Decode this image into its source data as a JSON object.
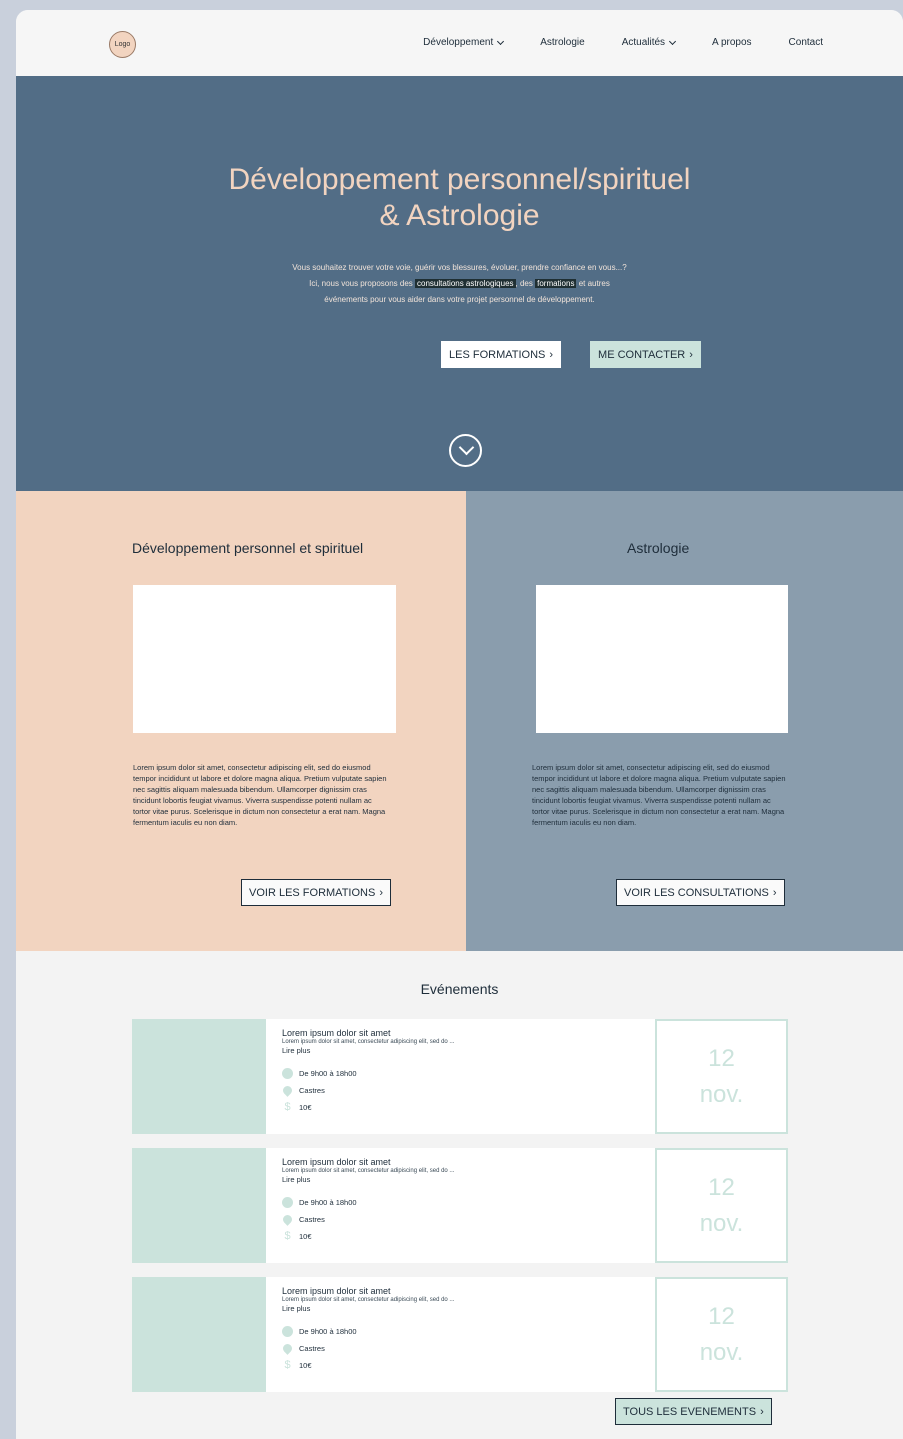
{
  "nav": {
    "logo": "Logo",
    "links": [
      {
        "label": "Développement",
        "dropdown": true
      },
      {
        "label": "Astrologie",
        "dropdown": false
      },
      {
        "label": "Actualités",
        "dropdown": true
      },
      {
        "label": "A propos",
        "dropdown": false
      },
      {
        "label": "Contact",
        "dropdown": false
      }
    ]
  },
  "hero": {
    "title_line1": "Développement personnel/spirituel",
    "title_line2": "& Astrologie",
    "text_line1": "Vous souhaitez trouver votre voie, guérir vos blessures, évoluer, prendre confiance en vous...?",
    "text_line2_a": "Ici, nous vous proposons des ",
    "text_line2_hl1": "consultations astrologiques",
    "text_line2_b": ", des ",
    "text_line2_hl2": "formations",
    "text_line2_c": " et autres",
    "text_line3": "événements pour vous aider dans votre projet personnel de développement.",
    "btn_formations": "LES FORMATIONS",
    "btn_contact": "ME CONTACTER",
    "arrow": "›"
  },
  "split": {
    "left": {
      "title": "Développement personnel et spirituel",
      "text": "Lorem ipsum dolor sit amet, consectetur adipiscing elit, sed do eiusmod tempor incididunt ut labore et dolore magna aliqua. Pretium vulputate sapien nec sagittis aliquam malesuada bibendum. Ullamcorper dignissim cras tincidunt lobortis feugiat vivamus. Viverra suspendisse potenti nullam ac tortor vitae purus. Scelerisque in dictum non consectetur a erat nam. Magna fermentum iaculis eu non diam.",
      "button": "VOIR LES FORMATIONS"
    },
    "right": {
      "title": "Astrologie",
      "text": "Lorem ipsum dolor sit amet, consectetur adipiscing elit, sed do eiusmod tempor incididunt ut labore et dolore magna aliqua. Pretium vulputate sapien nec sagittis aliquam malesuada bibendum. Ullamcorper dignissim cras tincidunt lobortis feugiat vivamus. Viverra suspendisse potenti nullam ac tortor vitae purus. Scelerisque in dictum non consectetur a erat nam. Magna fermentum iaculis eu non diam.",
      "button": "VOIR LES CONSULTATIONS"
    }
  },
  "events": {
    "title": "Evénements",
    "items": [
      {
        "title": "Lorem ipsum dolor sit amet",
        "desc": "Lorem ipsum dolor sit amet, consectetur adipiscing elit, sed do ...",
        "more": "Lire plus",
        "time": "De 9h00 à 18h00",
        "place": "Castres",
        "price": "10€",
        "day": "12",
        "month": "nov."
      },
      {
        "title": "Lorem ipsum dolor sit amet",
        "desc": "Lorem ipsum dolor sit amet, consectetur adipiscing elit, sed do ...",
        "more": "Lire plus",
        "time": "De 9h00 à 18h00",
        "place": "Castres",
        "price": "10€",
        "day": "12",
        "month": "nov."
      },
      {
        "title": "Lorem ipsum dolor sit amet",
        "desc": "Lorem ipsum dolor sit amet, consectetur adipiscing elit, sed do ...",
        "more": "Lire plus",
        "time": "De 9h00 à 18h00",
        "place": "Castres",
        "price": "10€",
        "day": "12",
        "month": "nov."
      }
    ],
    "all_button": "TOUS LES EVENEMENTS"
  },
  "colors": {
    "hero_bg": "#526d86",
    "peach": "#f2d4c0",
    "slate": "#8a9dad",
    "mint": "#cbe3dc",
    "dark_text": "#1e2d3a"
  }
}
